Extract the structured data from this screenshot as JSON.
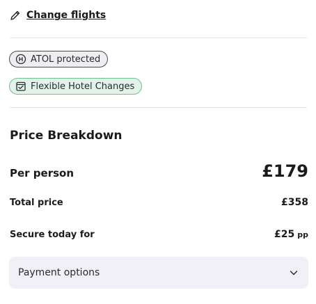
{
  "header": {
    "change_flights_label": "Change flights",
    "change_icon": "pencil-icon"
  },
  "badges": [
    {
      "label": "ATOL protected",
      "icon": "atol-icon",
      "bg": "#eeeef2",
      "border": "#4a4a55"
    },
    {
      "label": "Flexible Hotel Changes",
      "icon": "calendar-check-icon",
      "bg": "#e2f4ea",
      "border": "#6fbf8f"
    }
  ],
  "price": {
    "title": "Price Breakdown",
    "per_person_label": "Per person",
    "per_person_value": "£179",
    "total_label": "Total price",
    "total_value": "£358",
    "secure_label": "Secure today for",
    "secure_value": "£25",
    "secure_suffix": "pp"
  },
  "payment": {
    "label": "Payment options",
    "icon": "chevron-down-icon"
  }
}
